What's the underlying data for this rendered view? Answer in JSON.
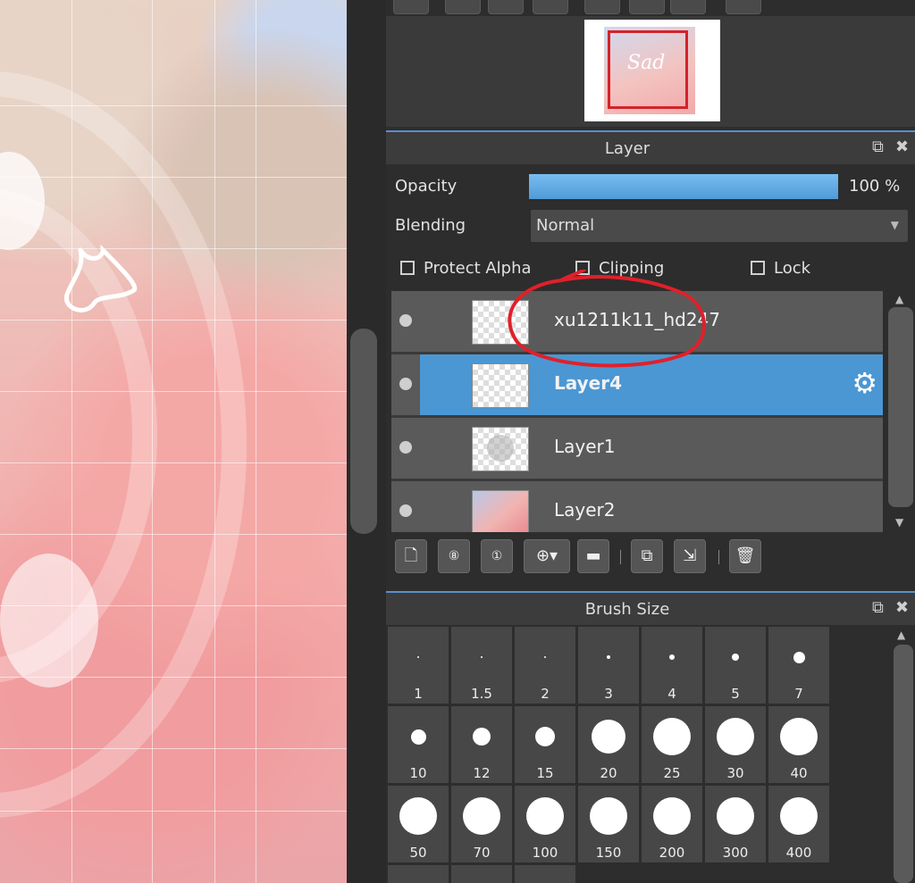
{
  "navigator": {
    "thumbnail_text": "Sad"
  },
  "layer_panel": {
    "title": "Layer",
    "opacity_label": "Opacity",
    "opacity_value": "100 %",
    "opacity_fraction": 1.0,
    "blending_label": "Blending",
    "blending_value": "Normal",
    "checkboxes": {
      "protect_alpha": "Protect Alpha",
      "clipping": "Clipping",
      "lock": "Lock"
    },
    "layers": [
      {
        "name": "xu1211k11_hd247",
        "selected": false,
        "thumb": "transparent"
      },
      {
        "name": "Layer4",
        "selected": true,
        "thumb": "transparent"
      },
      {
        "name": "Layer1",
        "selected": false,
        "thumb": "blur"
      },
      {
        "name": "Layer2",
        "selected": false,
        "thumb": "photo"
      }
    ],
    "accent_color": "#4b97d3",
    "annotation_color": "#e0202a"
  },
  "brush_panel": {
    "title": "Brush Size",
    "sizes": [
      "1",
      "1.5",
      "2",
      "3",
      "4",
      "5",
      "7",
      "10",
      "12",
      "15",
      "20",
      "25",
      "30",
      "40",
      "50",
      "70",
      "100",
      "150",
      "200",
      "300",
      "400"
    ]
  },
  "icons": [
    "popout-icon",
    "close-icon",
    "gear-icon",
    "new-layer-icon",
    "8bit-layer-icon",
    "1bit-layer-icon",
    "add-layer-icon",
    "folder-icon",
    "duplicate-icon",
    "merge-down-icon",
    "trash-icon"
  ]
}
